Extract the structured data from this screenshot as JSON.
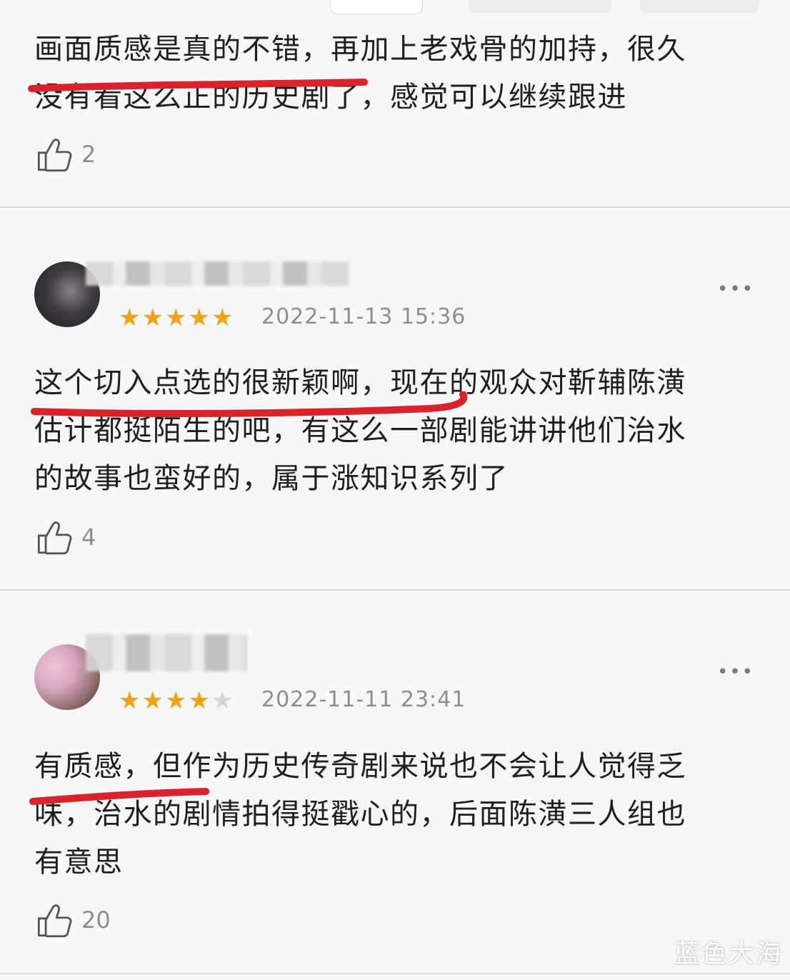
{
  "comments": [
    {
      "text_lines": [
        "画面质感是真的不错，再加上老戏骨的加持，很久",
        "没有看这么正的历史剧了，感觉可以继续跟进"
      ],
      "likes": "2"
    },
    {
      "rating": 5,
      "timestamp": "2022-11-13 15:36",
      "more": "•••",
      "text_lines": [
        "这个切入点选的很新颖啊，现在的观众对靳辅陈潢",
        "估计都挺陌生的吧，有这么一部剧能讲讲他们治水",
        "的故事也蛮好的，属于涨知识系列了"
      ],
      "likes": "4"
    },
    {
      "rating": 4,
      "timestamp": "2022-11-11 23:41",
      "more": "•••",
      "text_lines": [
        "有质感，但作为历史传奇剧来说也不会让人觉得乏",
        "味，治水的剧情拍得挺戳心的，后面陈潢三人组也",
        "有意思"
      ],
      "likes": "20"
    }
  ],
  "colors": {
    "underline": "#d9222a",
    "star": "#f2a20c",
    "star_off": "#d5d5d5"
  },
  "icons": {
    "like": "thumbs-up-icon",
    "more": "more-dots-icon"
  },
  "watermark": "蓝色大海"
}
